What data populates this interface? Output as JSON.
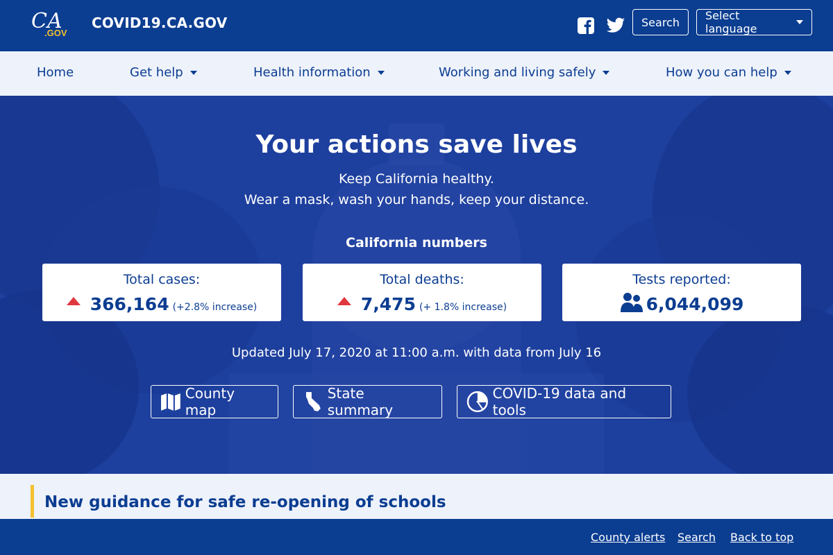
{
  "header": {
    "logo_text": "CA.GOV",
    "site_title": "COVID19.CA.GOV",
    "search_label": "Search",
    "language_label": "Select language"
  },
  "nav": {
    "items": [
      {
        "label": "Home",
        "dropdown": false
      },
      {
        "label": "Get help",
        "dropdown": true
      },
      {
        "label": "Health information",
        "dropdown": true
      },
      {
        "label": "Working and living safely",
        "dropdown": true
      },
      {
        "label": "How you can help",
        "dropdown": true
      }
    ]
  },
  "hero": {
    "title": "Your actions save lives",
    "line1": "Keep California healthy.",
    "line2": "Wear a mask, wash your hands, keep your distance.",
    "numbers_title": "California numbers",
    "stats": [
      {
        "label": "Total cases:",
        "value": "366,164",
        "change": "(+2.8% increase)",
        "icon": "triangle-up-icon"
      },
      {
        "label": "Total deaths:",
        "value": "7,475",
        "change": "(+ 1.8% increase)",
        "icon": "triangle-up-icon"
      },
      {
        "label": "Tests reported:",
        "value": "6,044,099",
        "change": "",
        "icon": "people-icon"
      }
    ],
    "updated": "Updated July 17, 2020 at 11:00 a.m. with data from July 16",
    "buttons": [
      {
        "label": "County map",
        "icon": "map-icon"
      },
      {
        "label": "State summary",
        "icon": "california-icon"
      },
      {
        "label": "COVID-19 data and tools",
        "icon": "pie-chart-icon"
      }
    ]
  },
  "guidance": {
    "title": "New guidance for safe re-opening of schools"
  },
  "footer": {
    "links": [
      "County alerts",
      "Search",
      "Back to top"
    ]
  },
  "colors": {
    "brand_blue": "#0b3d91",
    "accent_gold": "#f2c12e",
    "increase_red": "#e0383e",
    "nav_bg": "#eef2fb"
  }
}
